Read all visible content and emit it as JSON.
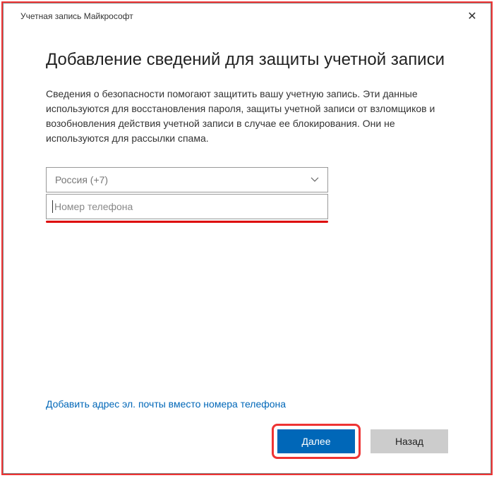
{
  "titlebar": {
    "title": "Учетная запись Майкрософт"
  },
  "content": {
    "heading": "Добавление сведений для защиты учетной записи",
    "description": "Сведения о безопасности помогают защитить вашу учетную запись. Эти данные используются для восстановления пароля, защиты учетной записи от взломщиков и возобновления действия учетной записи в случае ее блокирования. Они не используются для рассылки спама.",
    "country_select": {
      "selected": "Россия (+7)"
    },
    "phone_input": {
      "placeholder": "Номер телефона",
      "value": ""
    },
    "email_link": "Добавить адрес эл. почты вместо номера телефона",
    "buttons": {
      "next": "Далее",
      "back": "Назад"
    }
  }
}
